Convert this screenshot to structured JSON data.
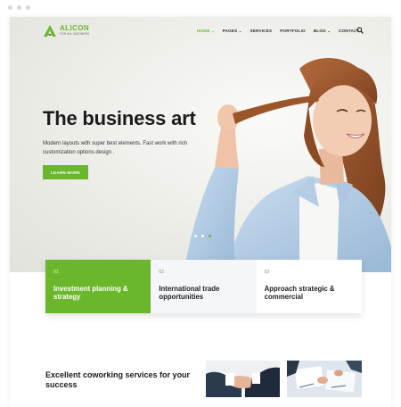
{
  "brand": {
    "name": "ALICON",
    "tagline": "FOR ALL BUSINESS",
    "accent": "#6ab72b"
  },
  "nav": {
    "items": [
      {
        "label": "HOME",
        "dropdown": true,
        "active": true
      },
      {
        "label": "PAGES",
        "dropdown": true,
        "active": false
      },
      {
        "label": "SERVICES",
        "dropdown": false,
        "active": false
      },
      {
        "label": "PORTFOLIO",
        "dropdown": false,
        "active": false
      },
      {
        "label": "BLOG",
        "dropdown": true,
        "active": false
      },
      {
        "label": "CONTACT",
        "dropdown": false,
        "active": false
      }
    ],
    "search_icon": "search-icon"
  },
  "hero": {
    "title": "The business art",
    "text": "Modern layouts with super best elements. Fast work with rich customization options design .",
    "button": "LEARN MORE",
    "slides": 3,
    "active_slide": 3
  },
  "features": [
    {
      "num": "01",
      "title": "Investment planning & strategy",
      "active": true
    },
    {
      "num": "02",
      "title": "International trade opportunities",
      "active": false
    },
    {
      "num": "03",
      "title": "Approach strategic & commercial",
      "active": false
    }
  ],
  "section": {
    "title": "Excellent coworking services for your success"
  }
}
